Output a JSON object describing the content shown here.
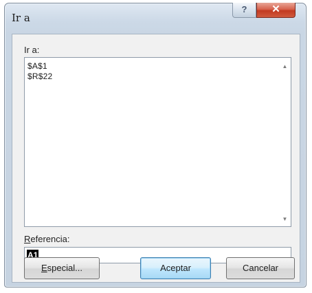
{
  "window": {
    "title": "Ir a"
  },
  "titlebar": {
    "help_glyph": "?",
    "close_glyph": "✕"
  },
  "goto": {
    "label": "Ir a:",
    "items": [
      "$A$1",
      "$R$22"
    ]
  },
  "reference": {
    "label_underlined": "R",
    "label_rest": "eferencia:",
    "value": "A1"
  },
  "buttons": {
    "especial_underlined": "E",
    "especial_rest": "special...",
    "aceptar": "Aceptar",
    "cancelar": "Cancelar"
  },
  "icons": {
    "scroll_up": "up-arrow-icon",
    "scroll_down": "down-arrow-icon"
  }
}
